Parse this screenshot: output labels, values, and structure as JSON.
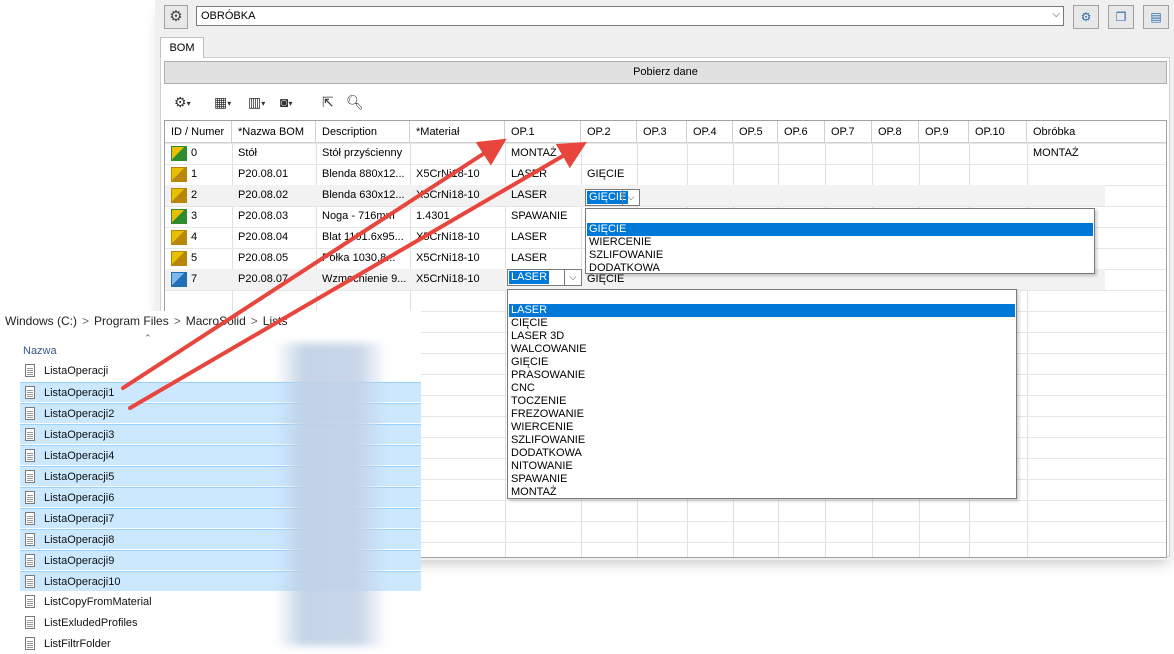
{
  "toolbar": {
    "settings_icon": "gear-icon",
    "profile_combo_value": "OBRÓBKA",
    "btn1_icon": "gear-refresh-icon",
    "btn2_icon": "windows-icon",
    "btn3_icon": "window-export-icon"
  },
  "tab": {
    "label": "BOM"
  },
  "fetch_button": "Pobierz dane",
  "grid": {
    "headers": [
      "ID / Numer",
      "*Nazwa BOM",
      "Description",
      "*Materiał",
      "OP.1",
      "OP.2",
      "OP.3",
      "OP.4",
      "OP.5",
      "OP.6",
      "OP.7",
      "OP.8",
      "OP.9",
      "OP.10",
      "Obróbka"
    ],
    "rows": [
      {
        "id": "0",
        "name": "Stół",
        "desc": "Stół przyścienny",
        "mat": "",
        "op1": "MONTAŻ",
        "op2": "",
        "obrobka": "MONTAŻ",
        "icon": "assembly-icon"
      },
      {
        "id": "1",
        "name": "P20.08.01",
        "desc": "Blenda 880x12...",
        "mat": "X5CrNi18-10",
        "op1": "LASER",
        "op2": "GIĘCIE",
        "obrobka": "",
        "icon": "sheet-metal-icon"
      },
      {
        "id": "2",
        "name": "P20.08.02",
        "desc": "Blenda 630x12...",
        "mat": "X5CrNi18-10",
        "op1": "LASER",
        "op2": "GIĘCIE",
        "obrobka": "",
        "icon": "sheet-metal-icon"
      },
      {
        "id": "3",
        "name": "P20.08.03",
        "desc": "Noga - 716mm",
        "mat": "1.4301",
        "op1": "SPAWANIE",
        "op2": "",
        "obrobka": "",
        "icon": "weldment-icon"
      },
      {
        "id": "4",
        "name": "P20.08.04",
        "desc": "Blat 1101.6x95...",
        "mat": "X5CrNi18-10",
        "op1": "LASER",
        "op2": "",
        "obrobka": "",
        "icon": "sheet-metal-icon"
      },
      {
        "id": "5",
        "name": "P20.08.05",
        "desc": "Półka 1030,8...",
        "mat": "X5CrNi18-10",
        "op1": "LASER",
        "op2": "",
        "obrobka": "",
        "icon": "sheet-metal-icon"
      },
      {
        "id": "7",
        "name": "P20.08.07",
        "desc": "Wzmocnienie 9...",
        "mat": "X5CrNi18-10",
        "op1": "LASER",
        "op2": "GIĘCIE",
        "obrobka": "",
        "icon": "sheet-metal-blue-icon"
      }
    ],
    "op2_dropdown": {
      "value": "GIĘCIE",
      "options": [
        "",
        "GIĘCIE",
        "WIERCENIE",
        "SZLIFOWANIE",
        "DODATKOWA"
      ],
      "highlighted": "GIĘCIE"
    },
    "op1_dropdown": {
      "value": "LASER",
      "options": [
        "",
        "LASER",
        "CIĘCIE",
        "LASER 3D",
        "WALCOWANIE",
        "GIĘCIE",
        "PRASOWANIE",
        "CNC",
        "TOCZENIE",
        "FREZOWANIE",
        "WIERCENIE",
        "SZLIFOWANIE",
        "DODATKOWA",
        "NITOWANIE",
        "SPAWANIE",
        "MONTAŻ"
      ],
      "highlighted": "LASER"
    }
  },
  "explorer": {
    "breadcrumb": [
      "Windows (C:)",
      ">",
      "Program Files",
      ">",
      "MacroSolid",
      ">",
      "Lists"
    ],
    "column_header": "Nazwa",
    "files": [
      {
        "name": "ListaOperacji",
        "selected": false
      },
      {
        "name": "ListaOperacji1",
        "selected": true
      },
      {
        "name": "ListaOperacji2",
        "selected": true
      },
      {
        "name": "ListaOperacji3",
        "selected": true
      },
      {
        "name": "ListaOperacji4",
        "selected": true
      },
      {
        "name": "ListaOperacji5",
        "selected": true
      },
      {
        "name": "ListaOperacji6",
        "selected": true
      },
      {
        "name": "ListaOperacji7",
        "selected": true
      },
      {
        "name": "ListaOperacji8",
        "selected": true
      },
      {
        "name": "ListaOperacji9",
        "selected": true
      },
      {
        "name": "ListaOperacji10",
        "selected": true
      },
      {
        "name": "ListCopyFromMaterial",
        "selected": false
      },
      {
        "name": "ListExludedProfiles",
        "selected": false
      },
      {
        "name": "ListFiltrFolder",
        "selected": false
      }
    ]
  },
  "annotation_color": "#e8453c"
}
